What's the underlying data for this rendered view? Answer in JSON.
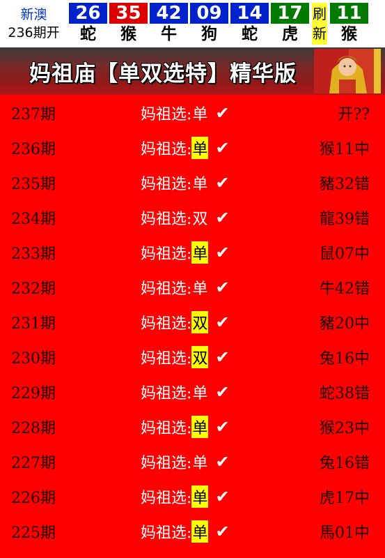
{
  "header": {
    "brand": "新澳",
    "issue": "236期开",
    "balls": [
      {
        "num": "26",
        "zodiac": "蛇",
        "color": "#0022cc"
      },
      {
        "num": "35",
        "zodiac": "猴",
        "color": "#dd0000"
      },
      {
        "num": "42",
        "zodiac": "牛",
        "color": "#0022cc"
      },
      {
        "num": "09",
        "zodiac": "狗",
        "color": "#0022cc"
      },
      {
        "num": "14",
        "zodiac": "蛇",
        "color": "#0022cc"
      },
      {
        "num": "17",
        "zodiac": "虎",
        "color": "#007a00"
      }
    ],
    "refresh_top": "刷",
    "refresh_bottom": "新",
    "special": {
      "num": "11",
      "zodiac": "猴",
      "color": "#007a00"
    }
  },
  "banner": {
    "title": "妈祖庙【单双选特】精华版"
  },
  "pick_label": "妈祖选:",
  "check_icon": "checkmark-icon",
  "rows": [
    {
      "period": "237期",
      "value": "单",
      "highlight": false,
      "result": "开??"
    },
    {
      "period": "236期",
      "value": "单",
      "highlight": true,
      "result": "猴11中"
    },
    {
      "period": "235期",
      "value": "单",
      "highlight": false,
      "result": "豬32错"
    },
    {
      "period": "234期",
      "value": "双",
      "highlight": false,
      "result": "龍39错"
    },
    {
      "period": "233期",
      "value": "单",
      "highlight": true,
      "result": "鼠07中"
    },
    {
      "period": "232期",
      "value": "单",
      "highlight": false,
      "result": "牛42错"
    },
    {
      "period": "231期",
      "value": "双",
      "highlight": true,
      "result": "豬20中"
    },
    {
      "period": "230期",
      "value": "双",
      "highlight": true,
      "result": "兔16中"
    },
    {
      "period": "229期",
      "value": "单",
      "highlight": false,
      "result": "蛇38错"
    },
    {
      "period": "228期",
      "value": "单",
      "highlight": true,
      "result": "猴23中"
    },
    {
      "period": "227期",
      "value": "单",
      "highlight": false,
      "result": "兔16错"
    },
    {
      "period": "226期",
      "value": "单",
      "highlight": true,
      "result": "虎17中"
    },
    {
      "period": "225期",
      "value": "单",
      "highlight": true,
      "result": "馬01中"
    }
  ]
}
